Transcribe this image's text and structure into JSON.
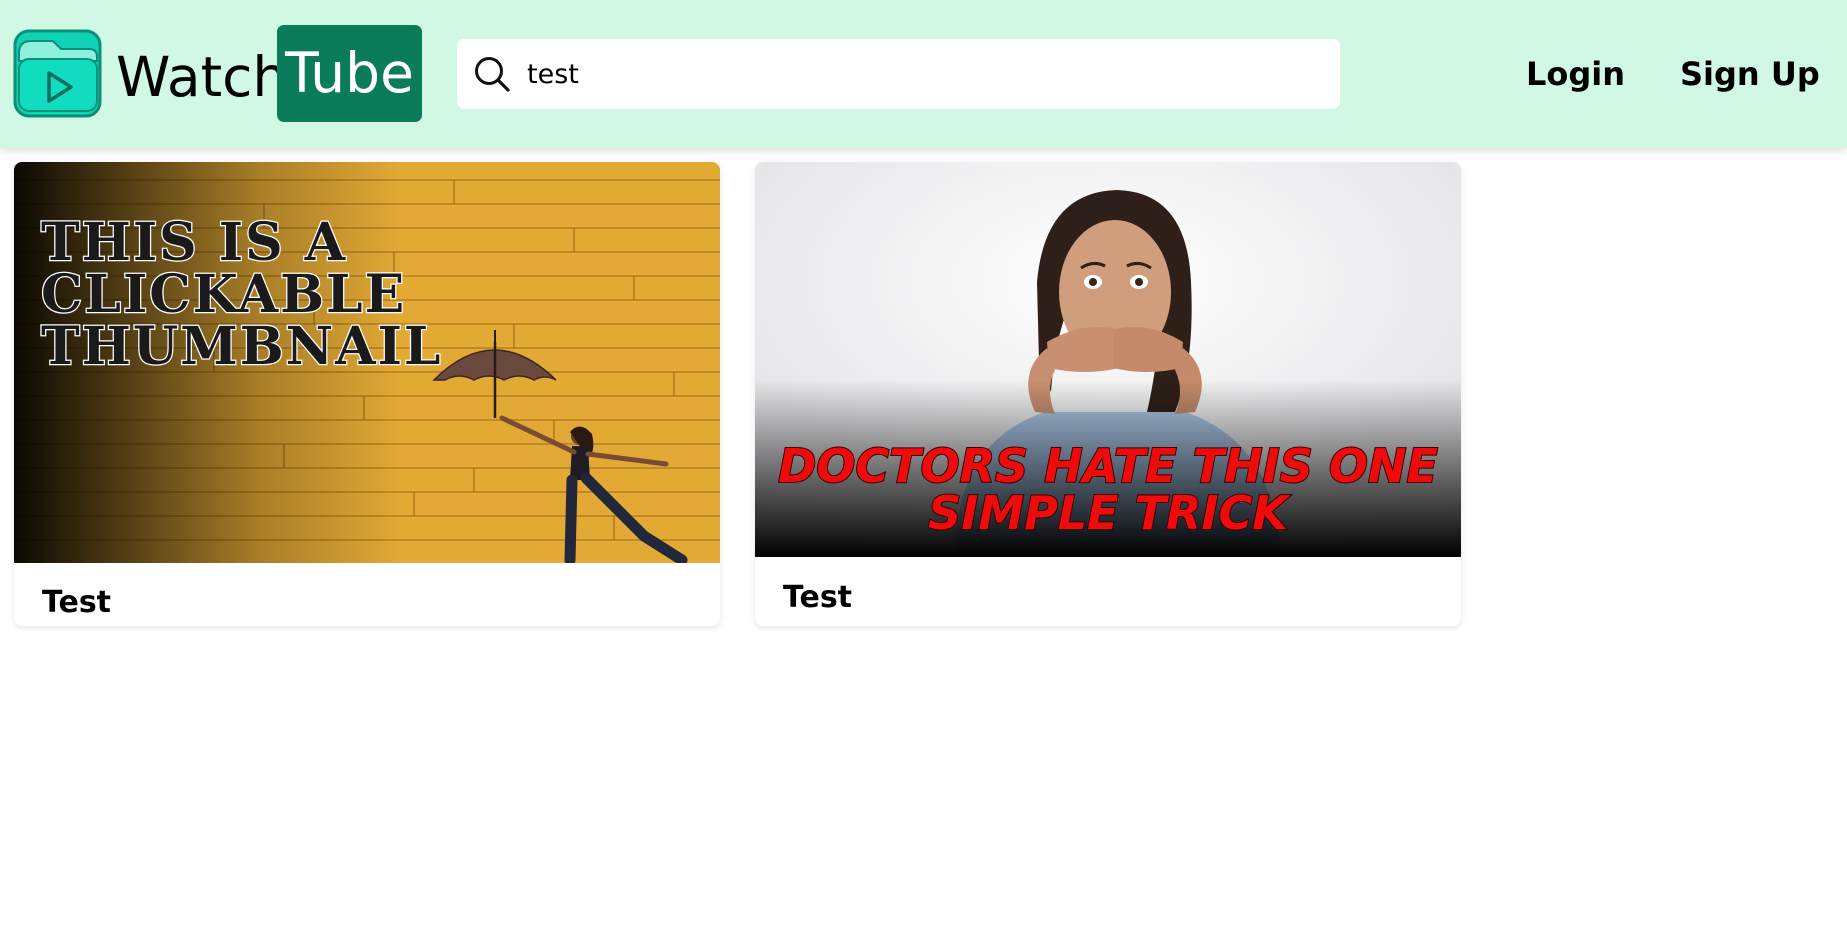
{
  "app": {
    "logo_icon": "play-folder-icon",
    "brand_watch": "Watch",
    "brand_tube": "Tube"
  },
  "search": {
    "icon": "search-icon",
    "value": "test"
  },
  "nav": {
    "login": "Login",
    "signup": "Sign Up"
  },
  "videos": [
    {
      "title": "Test",
      "thumbnail_lines": [
        "THIS IS A",
        "CLICKABLE",
        "THUMBNAIL"
      ]
    },
    {
      "title": "Test",
      "thumbnail_lines": [
        "DOCTORS HATE THIS ONE",
        "SIMPLE TRICK"
      ]
    }
  ],
  "colors": {
    "header_bg": "#d1f8e4",
    "brand_accent": "#0a7c59",
    "thumb1_wall": "#e2a935",
    "thumb2_text": "#ee0b0b"
  }
}
